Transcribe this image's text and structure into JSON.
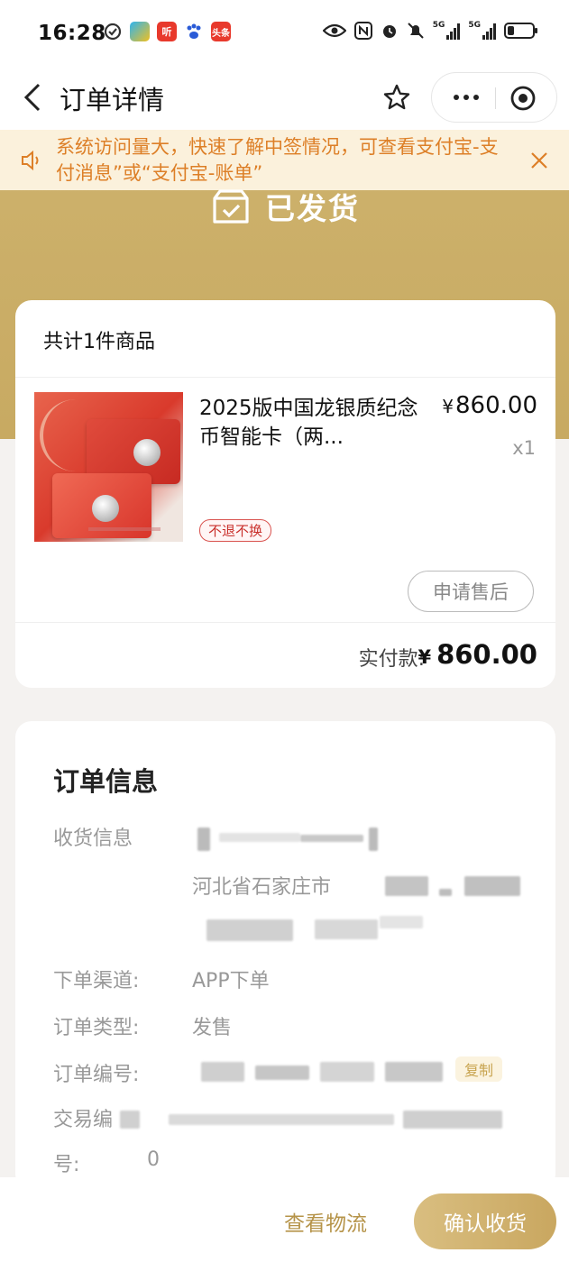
{
  "status_bar": {
    "time": "16:28",
    "network": "5G"
  },
  "nav": {
    "title": "订单详情"
  },
  "notice": {
    "text": "系统访问量大，快速了解中签情况，可查看支付宝-支付消息”或“支付宝-账单”"
  },
  "order_status": {
    "text": "已发货"
  },
  "products_card": {
    "header": "共计1件商品",
    "item": {
      "name": "2025版中国龙银质纪念币智能卡（两...",
      "price": "860.00",
      "currency": "¥",
      "qty": "x1",
      "tag": "不退不换"
    },
    "after_sale_button": "申请售后",
    "paid_label": "实付款:",
    "paid_amount": "860.00"
  },
  "order_info": {
    "title": "订单信息",
    "shipping_label": "收货信息",
    "shipping_address_visible": "河北省石家庄市",
    "channel_label": "下单渠道:",
    "channel_value": "APP下单",
    "type_label": "订单类型:",
    "type_value": "发售",
    "order_no_label": "订单编号:",
    "copy_label": "复制",
    "trade_no_label": "交易编",
    "trade_no_label2": "号:",
    "trade_no_visible": "0"
  },
  "bottom_bar": {
    "logistics_button": "查看物流",
    "confirm_button": "确认收货"
  },
  "colors": {
    "gold": "#c9a760",
    "notice_text": "#dd7f27",
    "tag_red": "#c9302c"
  }
}
